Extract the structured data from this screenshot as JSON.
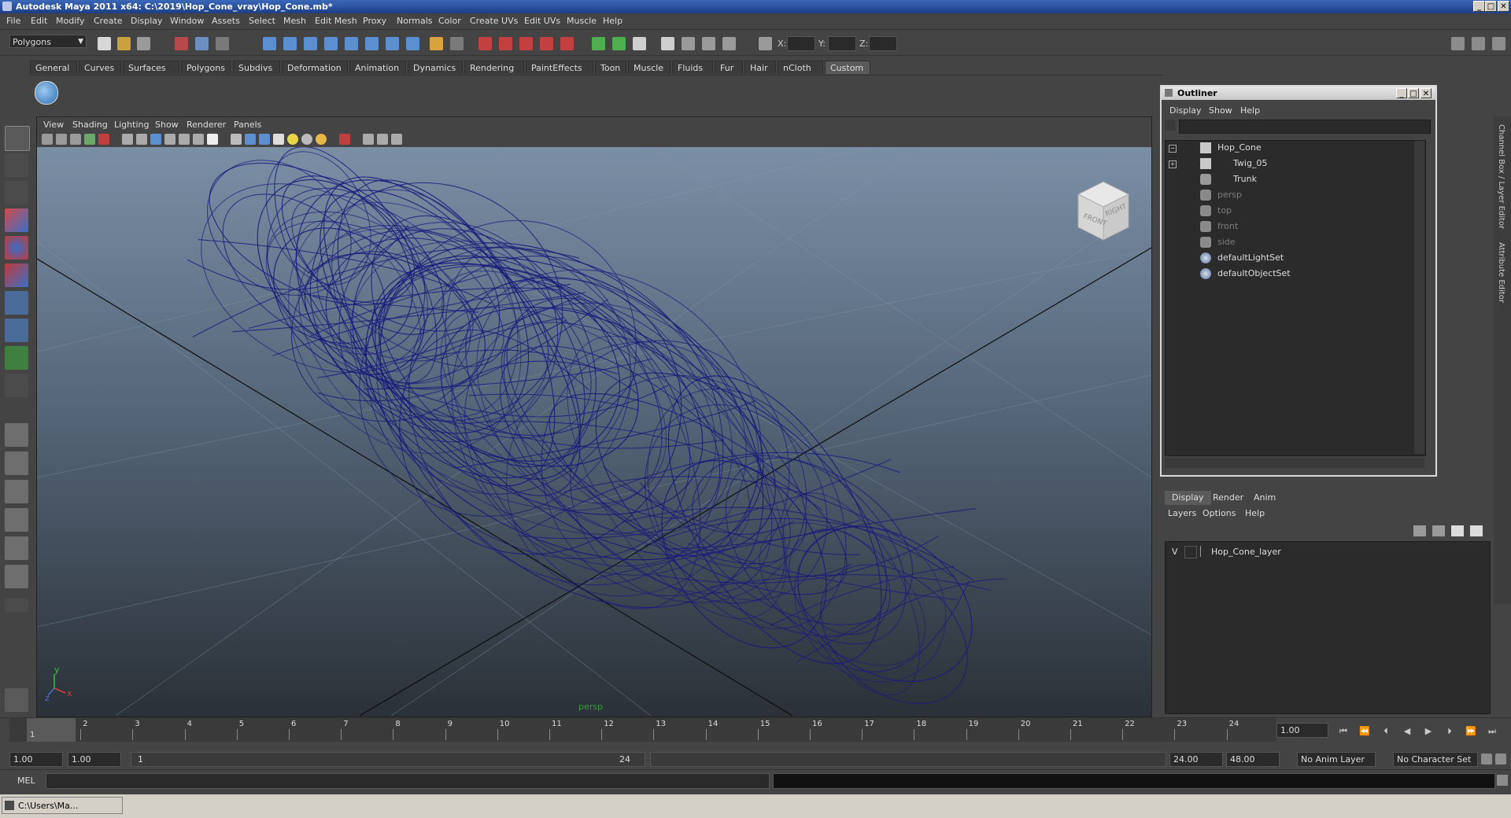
{
  "window": {
    "title": "Autodesk Maya 2011 x64: C:\\2019\\Hop_Cone_vray\\Hop_Cone.mb*",
    "controls": [
      "_",
      "□",
      "✕"
    ]
  },
  "menubar": [
    "File",
    "Edit",
    "Modify",
    "Create",
    "Display",
    "Window",
    "Assets",
    "Select",
    "Mesh",
    "Edit Mesh",
    "Proxy",
    "Normals",
    "Color",
    "Create UVs",
    "Edit UVs",
    "Muscle",
    "Help"
  ],
  "status": {
    "mode": "Polygons",
    "x_label": "X:",
    "y_label": "Y:",
    "z_label": "Z:"
  },
  "shelf_tabs": [
    "General",
    "Curves",
    "Surfaces",
    "Polygons",
    "Subdivs",
    "Deformation",
    "Animation",
    "Dynamics",
    "Rendering",
    "PaintEffects",
    "Toon",
    "Muscle",
    "Fluids",
    "Fur",
    "Hair",
    "nCloth",
    "Custom"
  ],
  "shelf_active": "Custom",
  "viewport": {
    "menu": [
      "View",
      "Shading",
      "Lighting",
      "Show",
      "Renderer",
      "Panels"
    ],
    "camera_label": "persp",
    "viewcube": {
      "front": "FRONT",
      "right": "RIGHT"
    },
    "axis": {
      "y": "y",
      "x": "x",
      "z": "z"
    },
    "wire_color": "#1a1a7a"
  },
  "outliner": {
    "title": "Outliner",
    "menu": [
      "Display",
      "Show",
      "Help"
    ],
    "items": [
      {
        "label": "Hop_Cone",
        "type": "transform",
        "dim": false
      },
      {
        "label": "Twig_05",
        "type": "transform",
        "dim": false
      },
      {
        "label": "Trunk",
        "type": "mesh",
        "dim": false
      },
      {
        "label": "persp",
        "type": "camera",
        "dim": true
      },
      {
        "label": "top",
        "type": "camera",
        "dim": true
      },
      {
        "label": "front",
        "type": "camera",
        "dim": true
      },
      {
        "label": "side",
        "type": "camera",
        "dim": true
      },
      {
        "label": "defaultLightSet",
        "type": "set",
        "dim": false
      },
      {
        "label": "defaultObjectSet",
        "type": "set",
        "dim": false
      }
    ]
  },
  "layers": {
    "tabs": [
      "Display",
      "Render",
      "Anim"
    ],
    "active_tab": "Display",
    "menu": [
      "Layers",
      "Options",
      "Help"
    ],
    "rows": [
      {
        "visible": "V",
        "name": "Hop_Cone_layer"
      }
    ]
  },
  "side_tabs": [
    "Channel Box / Layer Editor",
    "Attribute Editor"
  ],
  "timeline": {
    "ticks": [
      "1",
      "2",
      "3",
      "4",
      "5",
      "6",
      "7",
      "8",
      "9",
      "10",
      "11",
      "12",
      "13",
      "14",
      "15",
      "16",
      "17",
      "18",
      "19",
      "20",
      "21",
      "22",
      "23",
      "24"
    ],
    "current_marker": "1",
    "current_frame": "1.00"
  },
  "range": {
    "start": "1.00",
    "playback_start": "1.00",
    "slider_start": "1",
    "slider_end": "24",
    "playback_end": "24.00",
    "end": "48.00",
    "anim_layer": "No Anim Layer",
    "character_set": "No Character Set"
  },
  "command": {
    "label": "MEL"
  },
  "taskbar": {
    "item": "C:\\Users\\Ma..."
  }
}
